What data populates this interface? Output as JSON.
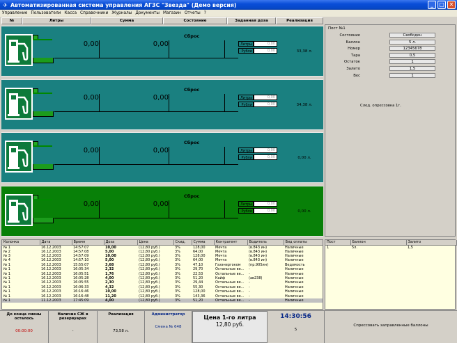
{
  "window": {
    "title": "Автоматизированная система управления АГЗС \"Звезда\" (Демо версия)"
  },
  "menu": [
    "Управление",
    "Пользователи",
    "Касса",
    "Справочники",
    "Журналы",
    "Документы",
    "Магазин",
    "Отчеты",
    "?"
  ],
  "columns": [
    "№",
    "Литры",
    "Сумма",
    "Состояние",
    "Заданная доза",
    "Реализация"
  ],
  "pumps": [
    {
      "num": "1",
      "liters": "0,00",
      "sum": "0,00",
      "state": "Сброс",
      "dose_liters_label": "Литры",
      "dose_liters": "0,00",
      "dose_rub_label": "Рубли",
      "dose_rub": "0,00",
      "realization": "33,38 л."
    },
    {
      "num": "2",
      "liters": "0,00",
      "sum": "0,00",
      "state": "Сброс",
      "dose_liters_label": "Литры",
      "dose_liters": "0,00",
      "dose_rub_label": "Рубли",
      "dose_rub": "0,00",
      "realization": "34,38 л."
    },
    {
      "num": "3",
      "liters": "0,00",
      "sum": "0,00",
      "state": "Сброс",
      "dose_liters_label": "Литры",
      "dose_liters": "0,00",
      "dose_rub_label": "Рубли",
      "dose_rub": "0,00",
      "realization": "0,00 л."
    },
    {
      "num": "4",
      "liters": "0,00",
      "sum": "0,00",
      "state": "Сброс",
      "dose_liters_label": "Литры",
      "dose_liters": "0,00",
      "dose_rub_label": "Рубли",
      "dose_rub": "0,00",
      "realization": "0,00 л."
    }
  ],
  "post_panel": {
    "title": "Пост №1",
    "fields": [
      {
        "label": "Состояние",
        "value": "Свободен"
      },
      {
        "label": "Баллон",
        "value": "5 л."
      },
      {
        "label": "Номер",
        "value": "12345678"
      },
      {
        "label": "Тара",
        "value": "0,5"
      },
      {
        "label": "Остаток",
        "value": "1"
      },
      {
        "label": "Залито",
        "value": "1,5"
      },
      {
        "label": "Вес",
        "value": "1"
      }
    ],
    "note": "След. опрессовка 1г."
  },
  "log": {
    "headers": [
      "Колонка",
      "Дата",
      "Время",
      "Доза",
      "Цена",
      "Скид.",
      "Сумма",
      "Контрагент",
      "Водитель",
      "Вид оплаты"
    ],
    "rows": [
      [
        "№ 1",
        "16.12.2003",
        "14:57:07",
        "10,00",
        "(12,80 руб.)",
        "3%",
        "128,00",
        "Мечта",
        "(в.843 ин)",
        "Наличные"
      ],
      [
        "№ 2",
        "16.12.2003",
        "14:57:08",
        "5,00",
        "(12,80 руб.)",
        "3%",
        "64,00",
        "Мечта",
        "(в.843 ин)",
        "Наличные"
      ],
      [
        "№ 3",
        "16.12.2003",
        "14:57:09",
        "10,00",
        "(12,80 руб.)",
        "3%",
        "128,00",
        "Мечта",
        "(в.843 ин)",
        "Наличные"
      ],
      [
        "№ 4",
        "16.12.2003",
        "14:57:10",
        "5,00",
        "(12,80 руб.)",
        "3%",
        "64,00",
        "Мечта",
        "(в.843 ин)",
        "Наличные"
      ],
      [
        "№ 1",
        "16.12.2003",
        "15:55:07",
        "3,68",
        "(12,80 руб.)",
        "3%",
        "47,10",
        "Газэнергоком",
        "(пр.905ин)",
        "Ведомость"
      ],
      [
        "№ 1",
        "16.12.2003",
        "16:05:34",
        "2,32",
        "(12,80 руб.)",
        "3%",
        "29,70",
        "Остальные ве...",
        "-",
        "Наличные"
      ],
      [
        "№ 1",
        "16.12.2003",
        "16:05:51",
        "1,76",
        "(12,80 руб.)",
        "3%",
        "22,53",
        "Остальные ве...",
        "-",
        "Наличные"
      ],
      [
        "№ 1",
        "16.12.2003",
        "16:05:28",
        "4,00",
        "(12,80 руб.)",
        "3%",
        "51,20",
        "Кайф",
        "(ав238)",
        "Наличные"
      ],
      [
        "№ 1",
        "16.12.2003",
        "16:05:55",
        "2,30",
        "(12,80 руб.)",
        "3%",
        "29,44",
        "Остальные ве...",
        "-",
        "Наличные"
      ],
      [
        "№ 1",
        "16.12.2003",
        "16:06:33",
        "4,32",
        "(12,80 руб.)",
        "3%",
        "55,30",
        "Остальные ве...",
        "-",
        "Наличные"
      ],
      [
        "№ 1",
        "16.12.2003",
        "16:16:46",
        "10,00",
        "(12,80 руб.)",
        "3%",
        "128,00",
        "Остальные ве...",
        "-",
        "Наличные"
      ],
      [
        "№ 1",
        "16.12.2003",
        "16:16:48",
        "11,20",
        "(12,80 руб.)",
        "3%",
        "143,36",
        "Остальные ве...",
        "-",
        "Наличные"
      ],
      [
        "№ 1",
        "11.12.2003",
        "17:45:09",
        "4,00",
        "(12,80 руб.)",
        "3%",
        "51,20",
        "Остальные ве...",
        "-",
        "Наличные"
      ]
    ]
  },
  "side_table": {
    "headers": [
      "Пост",
      "Баллон",
      "Залито"
    ],
    "rows": [
      [
        "1",
        "5л.",
        "1,5"
      ]
    ]
  },
  "status": {
    "shift_end_label": "До конца смены осталось",
    "shift_end_value": "00:00:00",
    "tanks_label": "Наличие СЖ в резервуарах",
    "tanks_value": "-",
    "realization_label": "Реализация",
    "realization_value": "73,58 л.",
    "admin_label": "Администратор",
    "shift_label": "Смена № 648",
    "price_title": "Цена 1-го литра",
    "price_value": "12,80 руб.",
    "clock": "14:30:56",
    "clock_sub": "5",
    "hint": "Спрессовать заправленные баллоны"
  }
}
